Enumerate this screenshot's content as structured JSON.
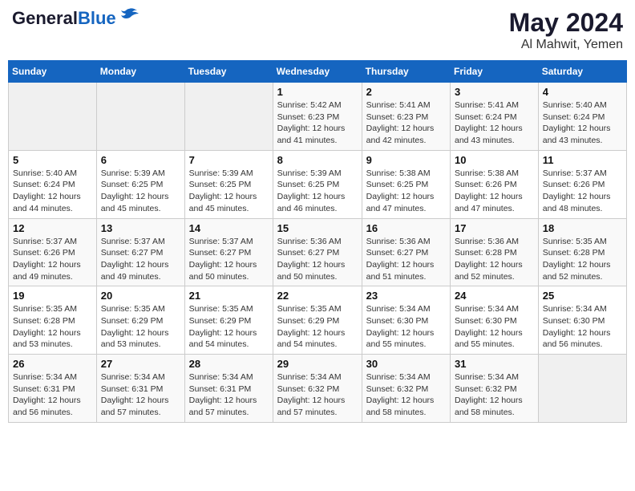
{
  "logo": {
    "general": "General",
    "blue": "Blue"
  },
  "title": "May 2024",
  "subtitle": "Al Mahwit, Yemen",
  "days_header": [
    "Sunday",
    "Monday",
    "Tuesday",
    "Wednesday",
    "Thursday",
    "Friday",
    "Saturday"
  ],
  "weeks": [
    [
      {
        "day": "",
        "sunrise": "",
        "sunset": "",
        "daylight": ""
      },
      {
        "day": "",
        "sunrise": "",
        "sunset": "",
        "daylight": ""
      },
      {
        "day": "",
        "sunrise": "",
        "sunset": "",
        "daylight": ""
      },
      {
        "day": "1",
        "sunrise": "Sunrise: 5:42 AM",
        "sunset": "Sunset: 6:23 PM",
        "daylight": "Daylight: 12 hours and 41 minutes."
      },
      {
        "day": "2",
        "sunrise": "Sunrise: 5:41 AM",
        "sunset": "Sunset: 6:23 PM",
        "daylight": "Daylight: 12 hours and 42 minutes."
      },
      {
        "day": "3",
        "sunrise": "Sunrise: 5:41 AM",
        "sunset": "Sunset: 6:24 PM",
        "daylight": "Daylight: 12 hours and 43 minutes."
      },
      {
        "day": "4",
        "sunrise": "Sunrise: 5:40 AM",
        "sunset": "Sunset: 6:24 PM",
        "daylight": "Daylight: 12 hours and 43 minutes."
      }
    ],
    [
      {
        "day": "5",
        "sunrise": "Sunrise: 5:40 AM",
        "sunset": "Sunset: 6:24 PM",
        "daylight": "Daylight: 12 hours and 44 minutes."
      },
      {
        "day": "6",
        "sunrise": "Sunrise: 5:39 AM",
        "sunset": "Sunset: 6:25 PM",
        "daylight": "Daylight: 12 hours and 45 minutes."
      },
      {
        "day": "7",
        "sunrise": "Sunrise: 5:39 AM",
        "sunset": "Sunset: 6:25 PM",
        "daylight": "Daylight: 12 hours and 45 minutes."
      },
      {
        "day": "8",
        "sunrise": "Sunrise: 5:39 AM",
        "sunset": "Sunset: 6:25 PM",
        "daylight": "Daylight: 12 hours and 46 minutes."
      },
      {
        "day": "9",
        "sunrise": "Sunrise: 5:38 AM",
        "sunset": "Sunset: 6:25 PM",
        "daylight": "Daylight: 12 hours and 47 minutes."
      },
      {
        "day": "10",
        "sunrise": "Sunrise: 5:38 AM",
        "sunset": "Sunset: 6:26 PM",
        "daylight": "Daylight: 12 hours and 47 minutes."
      },
      {
        "day": "11",
        "sunrise": "Sunrise: 5:37 AM",
        "sunset": "Sunset: 6:26 PM",
        "daylight": "Daylight: 12 hours and 48 minutes."
      }
    ],
    [
      {
        "day": "12",
        "sunrise": "Sunrise: 5:37 AM",
        "sunset": "Sunset: 6:26 PM",
        "daylight": "Daylight: 12 hours and 49 minutes."
      },
      {
        "day": "13",
        "sunrise": "Sunrise: 5:37 AM",
        "sunset": "Sunset: 6:27 PM",
        "daylight": "Daylight: 12 hours and 49 minutes."
      },
      {
        "day": "14",
        "sunrise": "Sunrise: 5:37 AM",
        "sunset": "Sunset: 6:27 PM",
        "daylight": "Daylight: 12 hours and 50 minutes."
      },
      {
        "day": "15",
        "sunrise": "Sunrise: 5:36 AM",
        "sunset": "Sunset: 6:27 PM",
        "daylight": "Daylight: 12 hours and 50 minutes."
      },
      {
        "day": "16",
        "sunrise": "Sunrise: 5:36 AM",
        "sunset": "Sunset: 6:27 PM",
        "daylight": "Daylight: 12 hours and 51 minutes."
      },
      {
        "day": "17",
        "sunrise": "Sunrise: 5:36 AM",
        "sunset": "Sunset: 6:28 PM",
        "daylight": "Daylight: 12 hours and 52 minutes."
      },
      {
        "day": "18",
        "sunrise": "Sunrise: 5:35 AM",
        "sunset": "Sunset: 6:28 PM",
        "daylight": "Daylight: 12 hours and 52 minutes."
      }
    ],
    [
      {
        "day": "19",
        "sunrise": "Sunrise: 5:35 AM",
        "sunset": "Sunset: 6:28 PM",
        "daylight": "Daylight: 12 hours and 53 minutes."
      },
      {
        "day": "20",
        "sunrise": "Sunrise: 5:35 AM",
        "sunset": "Sunset: 6:29 PM",
        "daylight": "Daylight: 12 hours and 53 minutes."
      },
      {
        "day": "21",
        "sunrise": "Sunrise: 5:35 AM",
        "sunset": "Sunset: 6:29 PM",
        "daylight": "Daylight: 12 hours and 54 minutes."
      },
      {
        "day": "22",
        "sunrise": "Sunrise: 5:35 AM",
        "sunset": "Sunset: 6:29 PM",
        "daylight": "Daylight: 12 hours and 54 minutes."
      },
      {
        "day": "23",
        "sunrise": "Sunrise: 5:34 AM",
        "sunset": "Sunset: 6:30 PM",
        "daylight": "Daylight: 12 hours and 55 minutes."
      },
      {
        "day": "24",
        "sunrise": "Sunrise: 5:34 AM",
        "sunset": "Sunset: 6:30 PM",
        "daylight": "Daylight: 12 hours and 55 minutes."
      },
      {
        "day": "25",
        "sunrise": "Sunrise: 5:34 AM",
        "sunset": "Sunset: 6:30 PM",
        "daylight": "Daylight: 12 hours and 56 minutes."
      }
    ],
    [
      {
        "day": "26",
        "sunrise": "Sunrise: 5:34 AM",
        "sunset": "Sunset: 6:31 PM",
        "daylight": "Daylight: 12 hours and 56 minutes."
      },
      {
        "day": "27",
        "sunrise": "Sunrise: 5:34 AM",
        "sunset": "Sunset: 6:31 PM",
        "daylight": "Daylight: 12 hours and 57 minutes."
      },
      {
        "day": "28",
        "sunrise": "Sunrise: 5:34 AM",
        "sunset": "Sunset: 6:31 PM",
        "daylight": "Daylight: 12 hours and 57 minutes."
      },
      {
        "day": "29",
        "sunrise": "Sunrise: 5:34 AM",
        "sunset": "Sunset: 6:32 PM",
        "daylight": "Daylight: 12 hours and 57 minutes."
      },
      {
        "day": "30",
        "sunrise": "Sunrise: 5:34 AM",
        "sunset": "Sunset: 6:32 PM",
        "daylight": "Daylight: 12 hours and 58 minutes."
      },
      {
        "day": "31",
        "sunrise": "Sunrise: 5:34 AM",
        "sunset": "Sunset: 6:32 PM",
        "daylight": "Daylight: 12 hours and 58 minutes."
      },
      {
        "day": "",
        "sunrise": "",
        "sunset": "",
        "daylight": ""
      }
    ]
  ]
}
